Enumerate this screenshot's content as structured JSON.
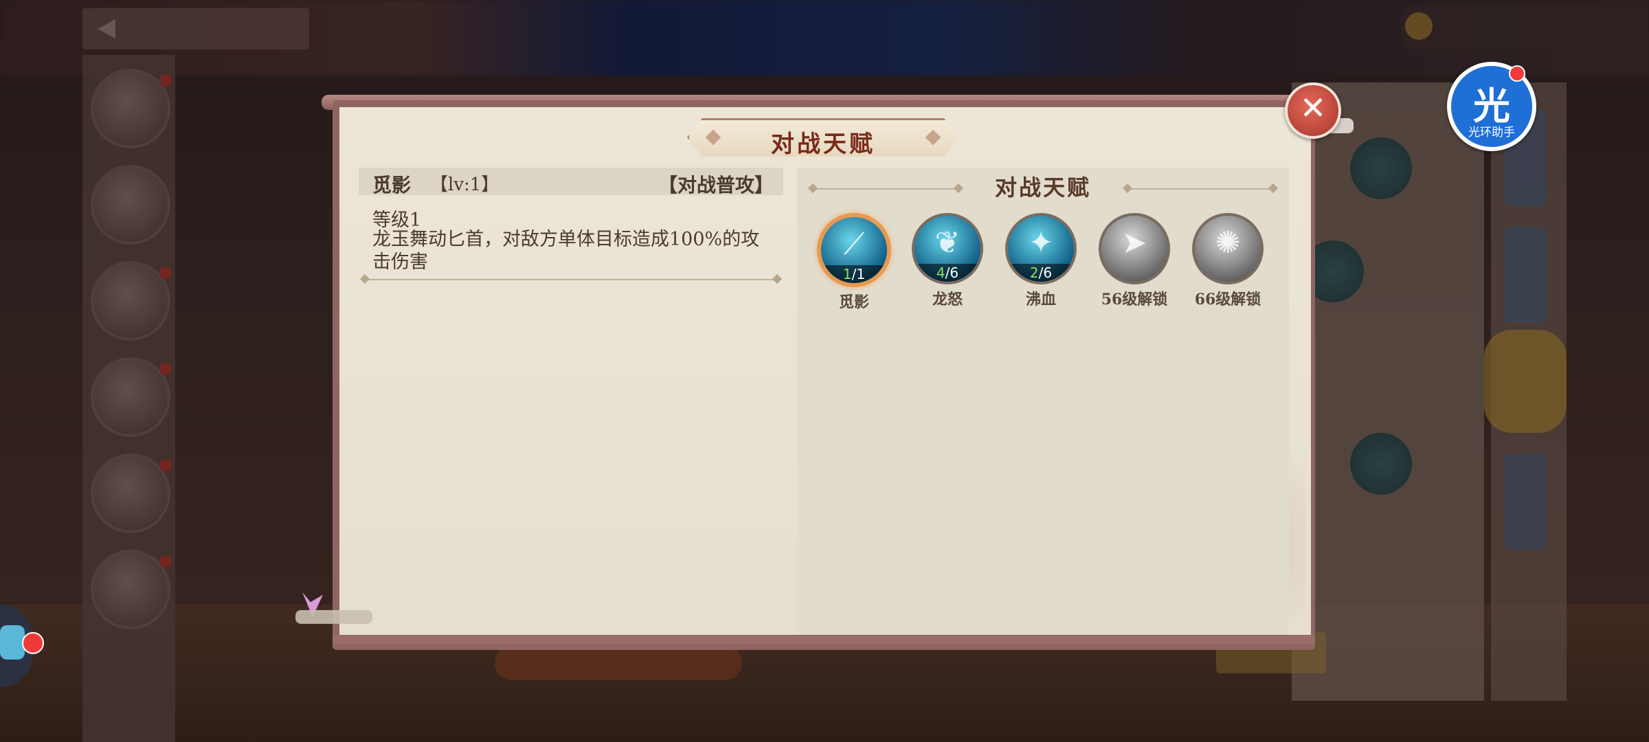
{
  "dialog": {
    "title": "对战天赋",
    "close_label": "✕"
  },
  "helper": {
    "glyph": "光",
    "label": "光环助手"
  },
  "skill_detail": {
    "name": "觅影",
    "level_tag": "【lv:1】",
    "type_tag": "【对战普攻】",
    "level_text": "等级1",
    "description": "龙玉舞动匕首，对敌方单体目标造成100%的攻击伤害"
  },
  "talents": {
    "heading": "对战天赋",
    "items": [
      {
        "name": "觅影",
        "current": "1",
        "max": "/1",
        "state": "selected",
        "icon": "blade-slash-icon"
      },
      {
        "name": "龙怒",
        "current": "4",
        "max": "/6",
        "state": "unlocked",
        "icon": "dragon-icon"
      },
      {
        "name": "沸血",
        "current": "2",
        "max": "/6",
        "state": "unlocked",
        "icon": "ice-burst-icon"
      },
      {
        "name": "56级解锁",
        "current": "",
        "max": "",
        "state": "locked",
        "icon": "dash-icon"
      },
      {
        "name": "66级解锁",
        "current": "",
        "max": "",
        "state": "locked",
        "icon": "shockwave-icon"
      }
    ]
  },
  "colors": {
    "title_text": "#7a2a1a",
    "body_text": "#4a3a30",
    "count_current": "#8fe06a",
    "selected_ring": "#e69a52",
    "close_button": "#c8473a",
    "helper_blue": "#1e6fd6"
  }
}
